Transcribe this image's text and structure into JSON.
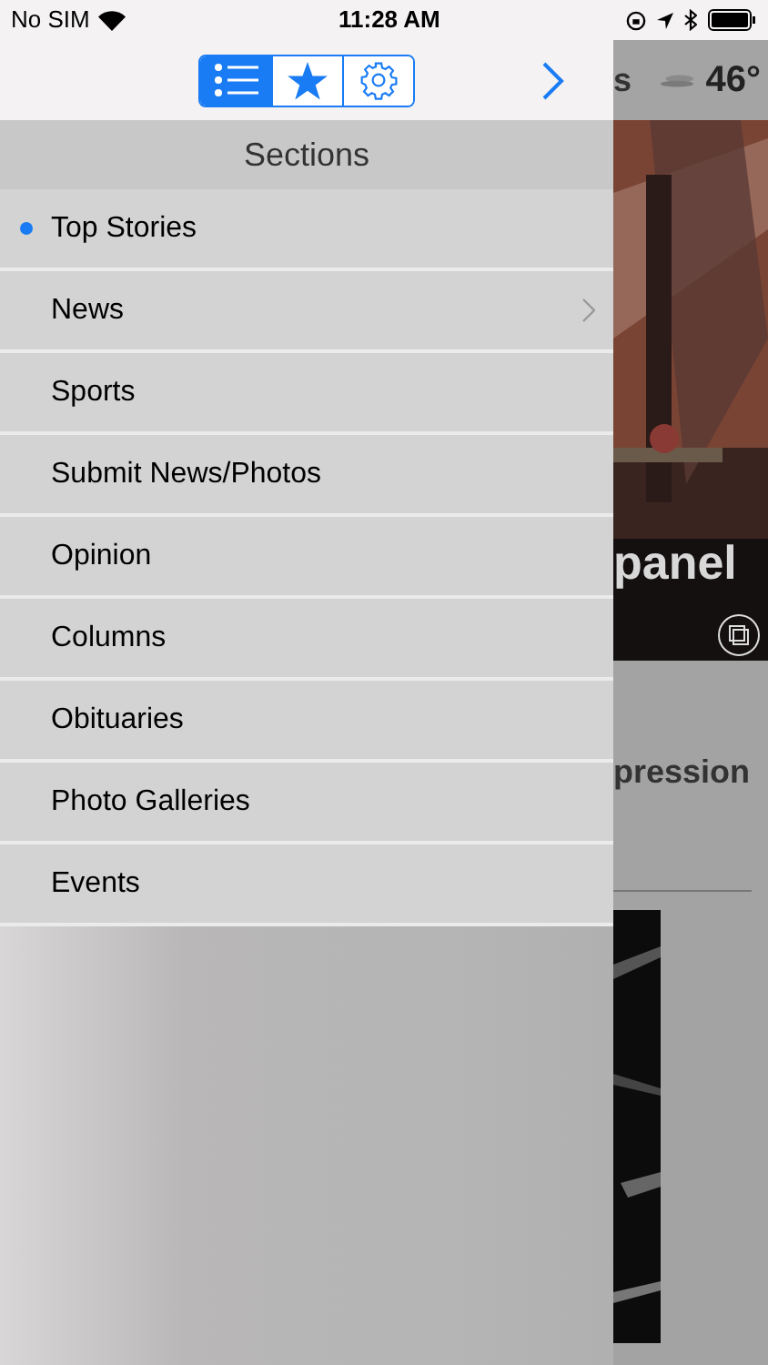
{
  "status_bar": {
    "carrier": "No SIM",
    "time": "11:28 AM"
  },
  "toolbar": {
    "tabs": [
      {
        "kind": "list",
        "selected": true
      },
      {
        "kind": "star",
        "selected": false
      },
      {
        "kind": "gear",
        "selected": false
      }
    ]
  },
  "drawer": {
    "title": "Sections",
    "items": [
      {
        "label": "Top Stories",
        "selected": true,
        "has_children": false
      },
      {
        "label": "News",
        "selected": false,
        "has_children": true
      },
      {
        "label": "Sports",
        "selected": false,
        "has_children": false
      },
      {
        "label": "Submit News/Photos",
        "selected": false,
        "has_children": false
      },
      {
        "label": "Opinion",
        "selected": false,
        "has_children": false
      },
      {
        "label": "Columns",
        "selected": false,
        "has_children": false
      },
      {
        "label": "Obituaries",
        "selected": false,
        "has_children": false
      },
      {
        "label": "Photo Galleries",
        "selected": false,
        "has_children": false
      },
      {
        "label": "Events",
        "selected": false,
        "has_children": false
      }
    ]
  },
  "background_page": {
    "header_fragment": "s",
    "temperature": "46°",
    "headline_fragment": "panel",
    "story_fragment": "pression"
  }
}
